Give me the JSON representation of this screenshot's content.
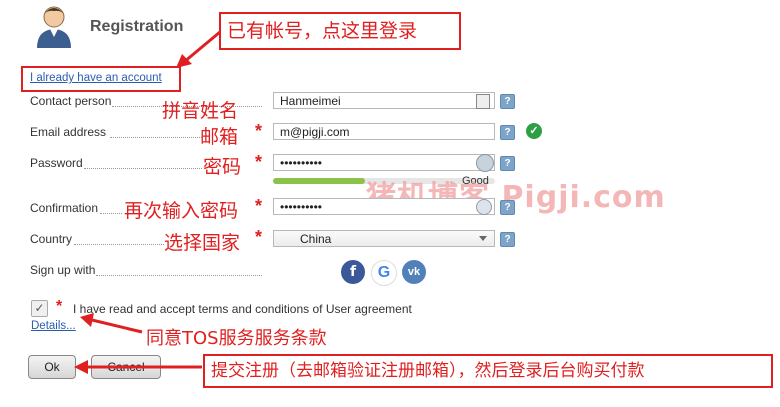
{
  "header": {
    "title": "Registration"
  },
  "annotations": {
    "top_hint": "已有帐号，点这里登录",
    "contact": "拼音姓名",
    "email": "邮箱",
    "password": "密码",
    "confirmation": "再次输入密码",
    "country": "选择国家",
    "tos": "同意TOS服务服务条款",
    "submit": "提交注册（去邮箱验证注册邮箱），然后登录后台购买付款",
    "watermark": "猪机博客 Pigji.com"
  },
  "login_link": "I already have an account",
  "form": {
    "contact": {
      "label": "Contact person",
      "value": "Hanmeimei"
    },
    "email": {
      "label": "Email address",
      "value": "m@pigji.com"
    },
    "password": {
      "label": "Password",
      "value": "••••••••••",
      "strength": "Good",
      "strength_level": 0.75
    },
    "confirmation": {
      "label": "Confirmation",
      "value": "••••••••••"
    },
    "country": {
      "label": "Country",
      "value": "China"
    },
    "signup_with": {
      "label": "Sign up with",
      "providers": [
        "facebook-icon",
        "google-icon",
        "vk-icon"
      ]
    },
    "agreement": {
      "text": "I have read and accept terms and conditions of User agreement",
      "checked": true
    },
    "details_link": "Details..."
  },
  "buttons": {
    "ok": "Ok",
    "cancel": "Cancel"
  },
  "colors": {
    "accent_red": "#e02020",
    "strength_green": "#8bc34a",
    "check_green": "#2ea043"
  }
}
